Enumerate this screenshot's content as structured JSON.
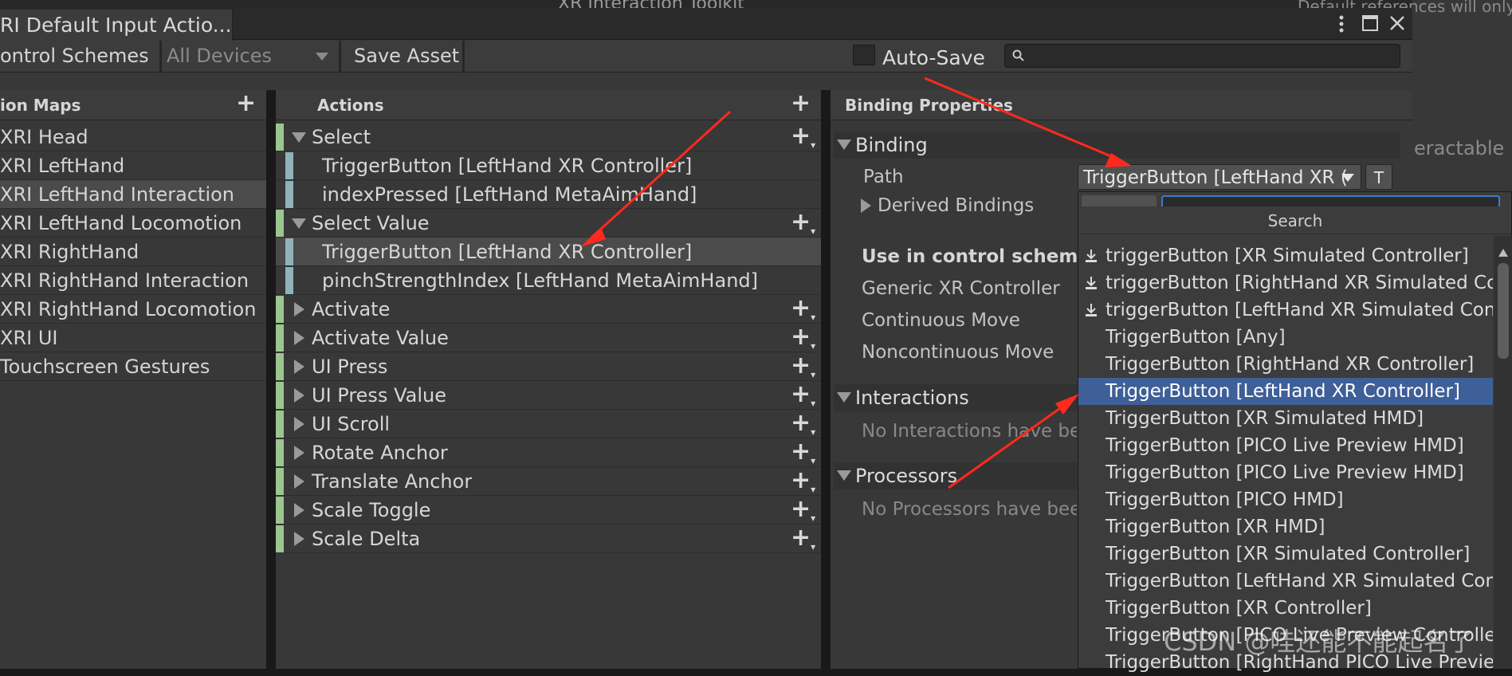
{
  "window": {
    "title": "RI Default Input Actio...",
    "menu_icon": "kebab-menu-icon",
    "maximize_icon": "maximize-icon",
    "close_icon": "close-icon",
    "bg_partial_title": "XR Interaction Toolkit",
    "bg_partial_right_text": "Default references will only",
    "bg_partial_right_text2": "eractable"
  },
  "toolbar": {
    "control_schemes": "ontrol Schemes",
    "all_devices": "All Devices",
    "save_asset": "Save Asset",
    "auto_save": "Auto-Save",
    "search_placeholder": ""
  },
  "action_maps": {
    "header": "ion Maps",
    "items": [
      "XRI Head",
      "XRI LeftHand",
      "XRI LeftHand Interaction",
      "XRI LeftHand Locomotion",
      "XRI RightHand",
      "XRI RightHand Interaction",
      "XRI RightHand Locomotion",
      "XRI UI",
      "Touchscreen Gestures"
    ],
    "selected_index": 2
  },
  "actions": {
    "header": "Actions",
    "rows": [
      {
        "label": "Select",
        "kind": "action",
        "expanded": true
      },
      {
        "label": "TriggerButton [LeftHand XR Controller]",
        "kind": "binding"
      },
      {
        "label": "indexPressed [LeftHand MetaAimHand]",
        "kind": "binding"
      },
      {
        "label": "Select Value",
        "kind": "action",
        "expanded": true
      },
      {
        "label": "TriggerButton [LeftHand XR Controller]",
        "kind": "binding",
        "selected": true
      },
      {
        "label": "pinchStrengthIndex [LeftHand MetaAimHand]",
        "kind": "binding"
      },
      {
        "label": "Activate",
        "kind": "action",
        "expanded": false
      },
      {
        "label": "Activate Value",
        "kind": "action",
        "expanded": false
      },
      {
        "label": "UI Press",
        "kind": "action",
        "expanded": false
      },
      {
        "label": "UI Press Value",
        "kind": "action",
        "expanded": false
      },
      {
        "label": "UI Scroll",
        "kind": "action",
        "expanded": false
      },
      {
        "label": "Rotate Anchor",
        "kind": "action",
        "expanded": false
      },
      {
        "label": "Translate Anchor",
        "kind": "action",
        "expanded": false
      },
      {
        "label": "Scale Toggle",
        "kind": "action",
        "expanded": false
      },
      {
        "label": "Scale Delta",
        "kind": "action",
        "expanded": false
      }
    ]
  },
  "binding_properties": {
    "header": "Binding Properties",
    "binding_section": "Binding",
    "path_label": "Path",
    "path_value": "TriggerButton [LeftHand XR (",
    "t_button": "T",
    "derived_bindings": "Derived Bindings",
    "use_in_control_scheme": "Use in control scheme",
    "schemes": [
      "Generic XR Controller",
      "Continuous Move",
      "Noncontinuous Move"
    ],
    "interactions_section": "Interactions",
    "interactions_empty": "No Interactions have bee",
    "processors_section": "Processors",
    "processors_empty": "No Processors have bee"
  },
  "dropdown": {
    "header": "Search",
    "items": [
      {
        "label": "triggerButton [XR Simulated Controller]",
        "icon": "download-icon"
      },
      {
        "label": "triggerButton [RightHand XR Simulated Con",
        "icon": "download-icon"
      },
      {
        "label": "triggerButton [LeftHand XR Simulated Contr",
        "icon": "download-icon"
      },
      {
        "label": "TriggerButton [Any]"
      },
      {
        "label": "TriggerButton [RightHand XR Controller]"
      },
      {
        "label": "TriggerButton [LeftHand XR Controller]",
        "selected": true
      },
      {
        "label": "TriggerButton [XR Simulated HMD]"
      },
      {
        "label": "TriggerButton [PICO Live Preview HMD]"
      },
      {
        "label": "TriggerButton [PICO Live Preview HMD]"
      },
      {
        "label": "TriggerButton [PICO HMD]"
      },
      {
        "label": "TriggerButton [XR HMD]"
      },
      {
        "label": "TriggerButton [XR Simulated Controller]"
      },
      {
        "label": "TriggerButton [LeftHand XR Simulated Cont"
      },
      {
        "label": "TriggerButton [XR Controller]"
      },
      {
        "label": "TriggerButton [PICO Live Preview Controller"
      },
      {
        "label": "TriggerButton [RightHand PICO Live Preview"
      }
    ]
  },
  "watermark": "CSDN @哇还能不能起名了",
  "colors": {
    "accent_selected": "#3e5f97",
    "annotation_arrow": "#ff2a1d",
    "action_stripe": "#9cc68f",
    "binding_stripe": "#8fb3b7"
  }
}
